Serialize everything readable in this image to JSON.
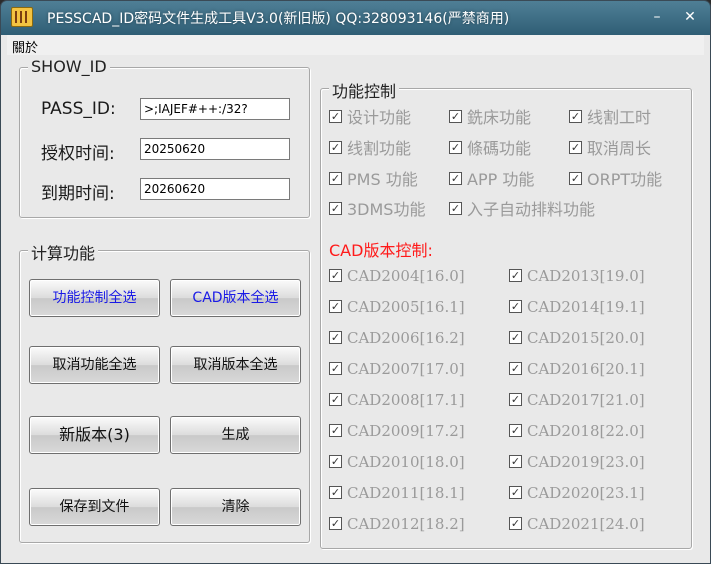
{
  "window": {
    "title": "PESSCAD_ID密码文件生成工具V3.0(新旧版)  QQ:328093146(严禁商用)",
    "minimize_glyph": "–",
    "close_glyph": "✕"
  },
  "menu": {
    "items": [
      "關於"
    ]
  },
  "show_id": {
    "legend": "SHOW_ID",
    "pass_id_label": "PASS_ID:",
    "pass_id_value": ">;IAJEF#++:/32?",
    "auth_time_label": "授权时间:",
    "auth_time_value": "20250620",
    "expire_time_label": "到期时间:",
    "expire_time_value": "20260620"
  },
  "calc": {
    "legend": "计算功能",
    "buttons": {
      "select_all_features": "功能控制全选",
      "select_all_cad": "CAD版本全选",
      "deselect_features": "取消功能全选",
      "deselect_cad": "取消版本全选",
      "new_version": "新版本(3)",
      "generate": "生成",
      "save_to_file": "保存到文件",
      "clear": "清除"
    }
  },
  "features": {
    "legend": "功能控制",
    "items": [
      "设计功能",
      "銑床功能",
      "线割工时",
      "线割功能",
      "條碼功能",
      "取消周长",
      "PMS 功能",
      "APP 功能",
      "ORPT功能",
      "3DMS功能",
      "入子自动排料功能"
    ]
  },
  "cad": {
    "title": "CAD版本控制:",
    "left": [
      "CAD2004[16.0]",
      "CAD2005[16.1]",
      "CAD2006[16.2]",
      "CAD2007[17.0]",
      "CAD2008[17.1]",
      "CAD2009[17.2]",
      "CAD2010[18.0]",
      "CAD2011[18.1]",
      "CAD2012[18.2]"
    ],
    "right": [
      "CAD2013[19.0]",
      "CAD2014[19.1]",
      "CAD2015[20.0]",
      "CAD2016[20.1]",
      "CAD2017[21.0]",
      "CAD2018[22.0]",
      "CAD2019[23.0]",
      "CAD2020[23.1]",
      "CAD2021[24.0]"
    ]
  },
  "checkmark": "✓"
}
